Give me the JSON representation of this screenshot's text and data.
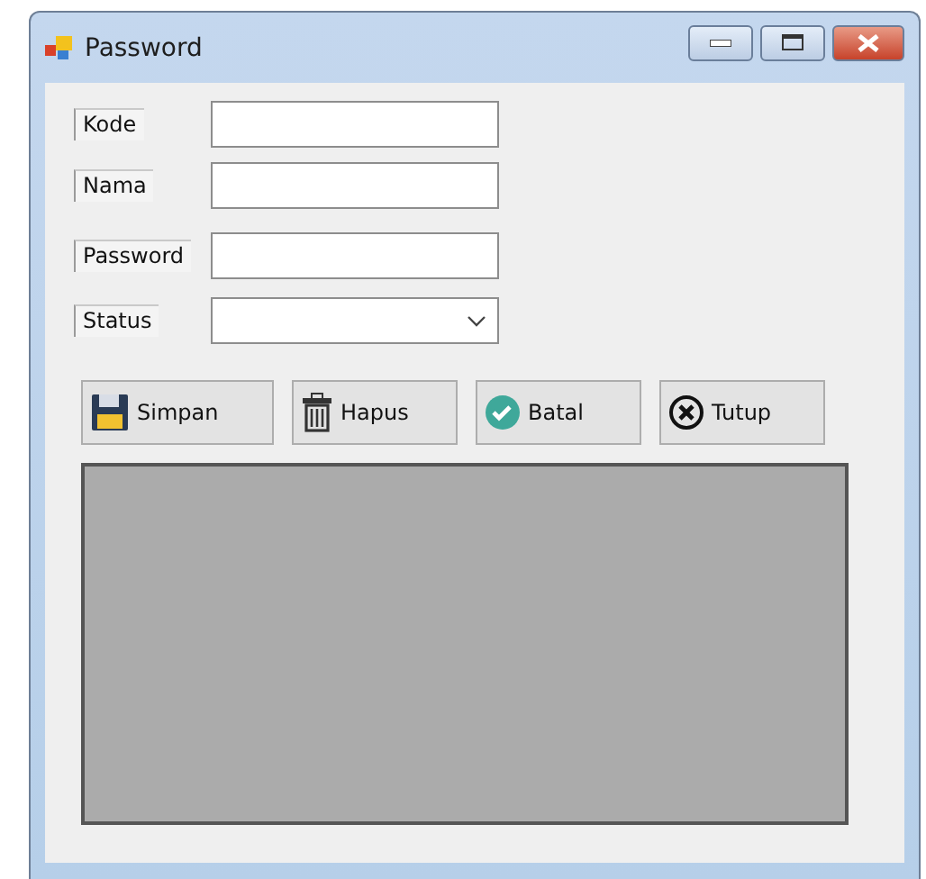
{
  "window": {
    "title": "Password"
  },
  "fields": [
    {
      "label": "Kode",
      "kind": "text"
    },
    {
      "label": "Nama",
      "kind": "text"
    },
    {
      "label": "Password",
      "kind": "text"
    },
    {
      "label": "Status",
      "kind": "dropdown"
    }
  ],
  "buttons": [
    {
      "label": "Simpan",
      "kind": "save"
    },
    {
      "label": "Hapus",
      "kind": "delete"
    },
    {
      "label": "Batal",
      "kind": "cancel"
    },
    {
      "label": "Tutup",
      "kind": "close"
    }
  ]
}
